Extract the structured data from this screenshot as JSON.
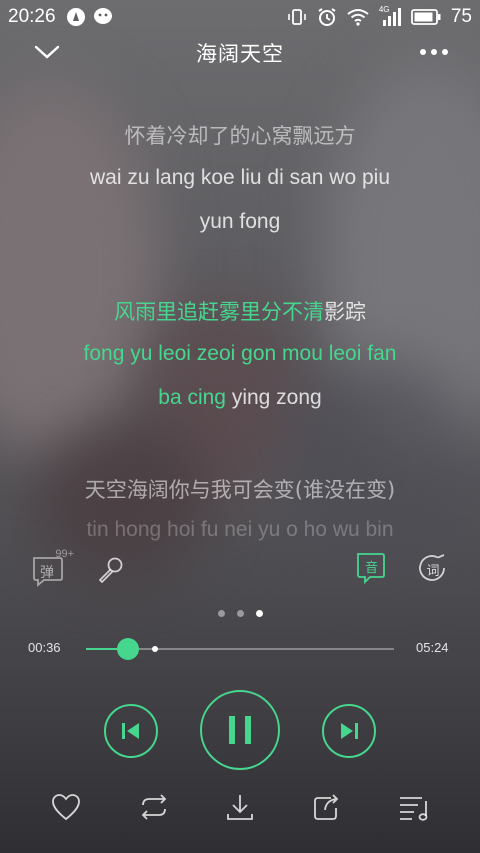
{
  "status_bar": {
    "time": "20:26",
    "network": "4G",
    "battery": "75"
  },
  "header": {
    "title": "海阔天空"
  },
  "lyrics": {
    "lines": [
      {
        "text": "怀着冷却了的心窝飘远方",
        "state": "dim"
      },
      {
        "text": "wai zu lang koe liu di san wo piu",
        "state": "mid"
      },
      {
        "text": "yun fong",
        "state": "mid"
      },
      {
        "text_sung": "风雨里追赶雾里分不清",
        "text_rest": "影踪",
        "state": "current"
      },
      {
        "text": "fong yu leoi zeoi gon mou leoi fan",
        "state": "green"
      },
      {
        "text_sung": "ba cing",
        "text_rest": " ying zong",
        "state": "current"
      },
      {
        "text": "天空海阔你与我可会变(谁没在变)",
        "state": "dim"
      },
      {
        "text": "tin hong hoi fu nei yu o ho wu bin",
        "state": "fade"
      }
    ]
  },
  "tools": {
    "danmu_label": "弹",
    "danmu_badge": "99+",
    "pinyin_label": "音",
    "lyrics_label": "词"
  },
  "pager": {
    "count": 3,
    "active": 2
  },
  "progress": {
    "current": "00:36",
    "total": "05:24",
    "played_fraction": 0.137,
    "buffered_fraction": 0.224
  },
  "colors": {
    "accent": "#46d68e",
    "text": "#ffffff"
  }
}
